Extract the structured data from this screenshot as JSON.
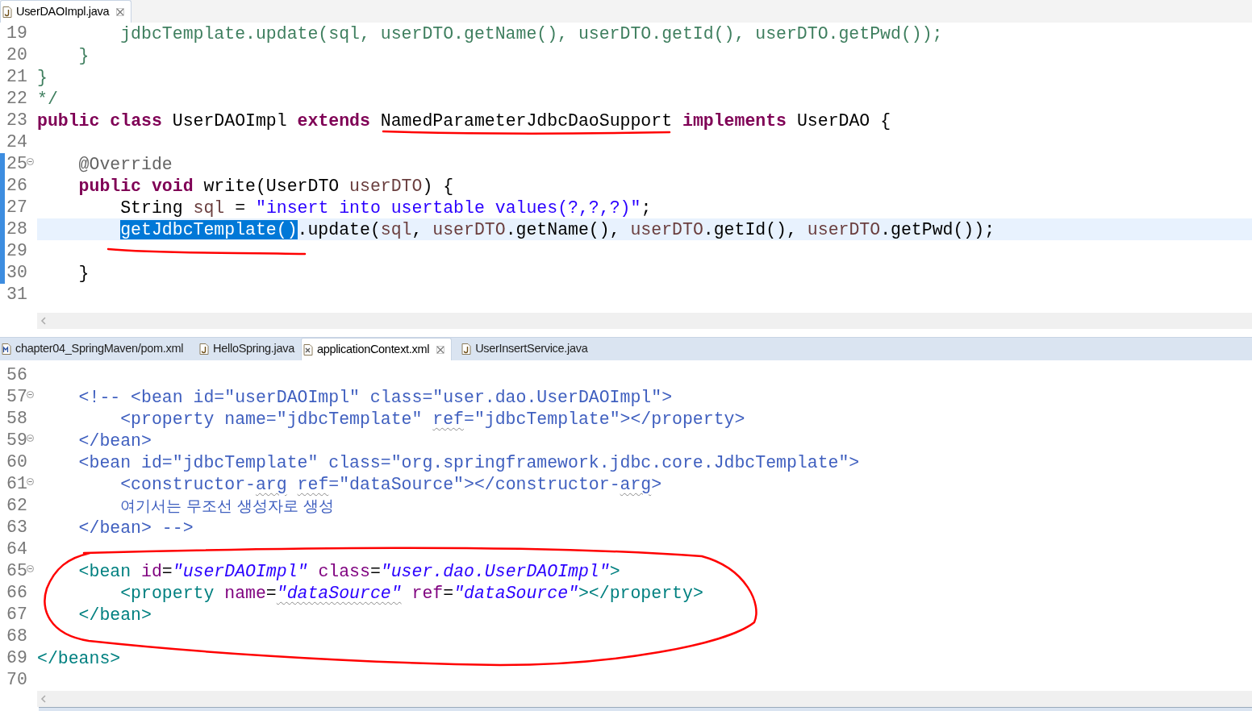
{
  "top_editor": {
    "tabs": [
      {
        "label": "UserDAOImpl.java",
        "kind": "java",
        "selected": true
      }
    ],
    "lines": [
      {
        "number": "19",
        "fold": false,
        "changed": false,
        "current": false,
        "tokens": [
          {
            "text": "        jdbcTemplate.update(sql, userDTO.getName(), userDTO.getId(), userDTO.getPwd());",
            "kind": "comment"
          }
        ]
      },
      {
        "number": "20",
        "fold": false,
        "changed": false,
        "current": false,
        "tokens": [
          {
            "text": "    }",
            "kind": "comment"
          }
        ]
      },
      {
        "number": "21",
        "fold": false,
        "changed": false,
        "current": false,
        "tokens": [
          {
            "text": "}",
            "kind": "comment"
          }
        ]
      },
      {
        "number": "22",
        "fold": false,
        "changed": false,
        "current": false,
        "tokens": [
          {
            "text": "*/",
            "kind": "comment"
          }
        ]
      },
      {
        "number": "23",
        "fold": false,
        "changed": false,
        "current": false,
        "tokens": [
          {
            "text": "public",
            "kind": "keyword"
          },
          {
            "text": " class",
            "kind": "keyword"
          },
          {
            "text": " UserDAOImpl ",
            "kind": "plain"
          },
          {
            "text": "extends",
            "kind": "keyword"
          },
          {
            "text": " NamedParameterJdbcDaoSupport ",
            "kind": "plain"
          },
          {
            "text": "implements",
            "kind": "keyword"
          },
          {
            "text": " UserDAO {",
            "kind": "plain"
          }
        ]
      },
      {
        "number": "24",
        "fold": false,
        "changed": false,
        "current": false
      },
      {
        "number": "25",
        "fold": true,
        "changed": true,
        "current": false,
        "tokens": [
          {
            "text": "    @Override",
            "kind": "annotation"
          }
        ]
      },
      {
        "number": "26",
        "fold": false,
        "changed": true,
        "current": false,
        "tokens": [
          {
            "text": "    public",
            "kind": "keyword"
          },
          {
            "text": " void",
            "kind": "keyword"
          },
          {
            "text": " write(UserDTO ",
            "kind": "plain"
          },
          {
            "text": "userDTO",
            "kind": "local"
          },
          {
            "text": ") {",
            "kind": "plain"
          }
        ]
      },
      {
        "number": "27",
        "fold": false,
        "changed": true,
        "current": false,
        "tokens": [
          {
            "text": "        String ",
            "kind": "plain"
          },
          {
            "text": "sql",
            "kind": "local"
          },
          {
            "text": " = ",
            "kind": "plain"
          },
          {
            "text": "\"insert into usertable values(?,?,?)\"",
            "kind": "string"
          },
          {
            "text": ";",
            "kind": "plain"
          }
        ]
      },
      {
        "number": "28",
        "fold": false,
        "changed": true,
        "current": true,
        "tokens": [
          {
            "text": "        getJdbcTemplate()",
            "kind": "selection"
          },
          {
            "text": ".update(",
            "kind": "plain"
          },
          {
            "text": "sql",
            "kind": "local"
          },
          {
            "text": ", ",
            "kind": "plain"
          },
          {
            "text": "userDTO",
            "kind": "local"
          },
          {
            "text": ".getName(), ",
            "kind": "plain"
          },
          {
            "text": "userDTO",
            "kind": "local"
          },
          {
            "text": ".getId(), ",
            "kind": "plain"
          },
          {
            "text": "userDTO",
            "kind": "local"
          },
          {
            "text": ".getPwd());",
            "kind": "plain"
          }
        ]
      },
      {
        "number": "29",
        "fold": false,
        "changed": true,
        "current": false
      },
      {
        "number": "30",
        "fold": false,
        "changed": true,
        "current": false,
        "tokens": [
          {
            "text": "    }",
            "kind": "plain"
          }
        ]
      },
      {
        "number": "31",
        "fold": false,
        "changed": false,
        "current": false
      }
    ]
  },
  "bottom_editor": {
    "tabs": [
      {
        "label": "chapter04_SpringMaven/pom.xml",
        "kind": "maven",
        "selected": false
      },
      {
        "label": "HelloSpring.java",
        "kind": "java",
        "selected": false
      },
      {
        "label": "applicationContext.xml",
        "kind": "xml",
        "selected": true
      },
      {
        "label": "UserInsertService.java",
        "kind": "java",
        "selected": false
      }
    ],
    "lines": [
      {
        "number": "56",
        "fold": false
      },
      {
        "number": "57",
        "fold": true,
        "tokens": [
          {
            "text": "    <!-- <bean id=\"userDAOImpl\" class=\"user.dao.UserDAOImpl\">",
            "kind": "xml_comment"
          }
        ]
      },
      {
        "number": "58",
        "fold": false,
        "tokens": [
          {
            "text": "        <property name=\"jdbcTemplate\" ",
            "kind": "xml_comment"
          },
          {
            "text": "ref",
            "kind": "xml_comment",
            "misspelled": true
          },
          {
            "text": "=\"jdbcTemplate\"></property>",
            "kind": "xml_comment"
          }
        ]
      },
      {
        "number": "59",
        "fold": true,
        "tokens": [
          {
            "text": "    </bean>",
            "kind": "xml_comment"
          }
        ]
      },
      {
        "number": "60",
        "fold": false,
        "tokens": [
          {
            "text": "    <bean id=\"jdbcTemplate\" class=\"org.springframework.jdbc.core.JdbcTemplate\">",
            "kind": "xml_comment"
          }
        ]
      },
      {
        "number": "61",
        "fold": true,
        "tokens": [
          {
            "text": "        <constructor-",
            "kind": "xml_comment"
          },
          {
            "text": "arg",
            "kind": "xml_comment",
            "misspelled": true
          },
          {
            "text": " ref",
            "kind": "xml_comment",
            "misspelled": true
          },
          {
            "text": "=\"dataSource\"></constructor-",
            "kind": "xml_comment"
          },
          {
            "text": "arg",
            "kind": "xml_comment",
            "misspelled": true
          },
          {
            "text": ">",
            "kind": "xml_comment"
          }
        ]
      },
      {
        "number": "62",
        "fold": false,
        "tokens": [
          {
            "text": "        여기서는 무조선 생성자로 생성",
            "kind": "xml_comment_cjk"
          }
        ]
      },
      {
        "number": "63",
        "fold": false,
        "tokens": [
          {
            "text": "    </bean> -->",
            "kind": "xml_comment"
          }
        ]
      },
      {
        "number": "64",
        "fold": false
      },
      {
        "number": "65",
        "fold": true,
        "tokens": [
          {
            "text": "    <bean",
            "kind": "tag"
          },
          {
            "text": " id",
            "kind": "attribute"
          },
          {
            "text": "=",
            "kind": "plain"
          },
          {
            "text": "\"userDAOImpl\"",
            "kind": "value"
          },
          {
            "text": " class",
            "kind": "attribute"
          },
          {
            "text": "=",
            "kind": "plain"
          },
          {
            "text": "\"user.dao.UserDAOImpl\"",
            "kind": "value"
          },
          {
            "text": ">",
            "kind": "tag"
          }
        ]
      },
      {
        "number": "66",
        "fold": false,
        "tokens": [
          {
            "text": "        <property",
            "kind": "tag"
          },
          {
            "text": " name",
            "kind": "attribute"
          },
          {
            "text": "=",
            "kind": "plain"
          },
          {
            "text": "\"dataSource\"",
            "kind": "value",
            "misspelled": true
          },
          {
            "text": " ref",
            "kind": "attribute"
          },
          {
            "text": "=",
            "kind": "plain"
          },
          {
            "text": "\"dataSource\"",
            "kind": "value"
          },
          {
            "text": "></property>",
            "kind": "tag"
          }
        ]
      },
      {
        "number": "67",
        "fold": false,
        "tokens": [
          {
            "text": "    </bean>",
            "kind": "tag"
          }
        ]
      },
      {
        "number": "68",
        "fold": false
      },
      {
        "number": "69",
        "fold": false,
        "tokens": [
          {
            "text": "</beans>",
            "kind": "tag"
          }
        ]
      },
      {
        "number": "70",
        "fold": false
      }
    ]
  }
}
